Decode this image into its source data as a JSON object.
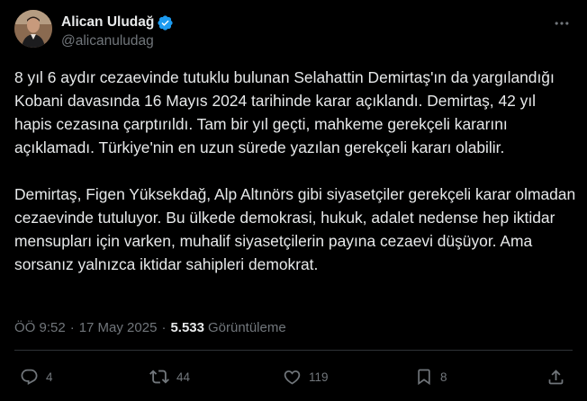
{
  "author": {
    "display_name": "Alican Uludağ",
    "handle": "@alicanuludag",
    "verified": true
  },
  "tweet": {
    "paragraphs": [
      "8 yıl 6 aydır cezaevinde tutuklu bulunan Selahattin Demirtaş'ın da yargılandığı Kobani davasında 16 Mayıs 2024 tarihinde karar açıklandı. Demirtaş, 42 yıl hapis cezasına çarptırıldı. Tam bir yıl geçti, mahkeme gerekçeli kararını açıklamadı. Türkiye'nin en uzun sürede yazılan gerekçeli kararı olabilir.",
      "Demirtaş, Figen Yüksekdağ, Alp Altınörs gibi siyasetçiler gerekçeli karar olmadan cezaevinde tutuluyor. Bu ülkede demokrasi, hukuk, adalet nedense hep iktidar mensupları için varken, muhalif siyasetçilerin payına cezaevi düşüyor. Ama sorsanız yalnızca iktidar sahipleri demokrat."
    ],
    "time": "ÖÖ 9:52",
    "separator": "·",
    "date": "17 May 2025",
    "views_count": "5.533",
    "views_label": "Görüntüleme"
  },
  "actions": {
    "replies": "4",
    "reposts": "44",
    "likes": "119",
    "bookmarks": "8"
  },
  "icons": {
    "more": "more-dots-icon",
    "verified": "verified-badge-icon",
    "reply": "reply-icon",
    "repost": "repost-icon",
    "like": "like-icon",
    "bookmark": "bookmark-icon",
    "share": "share-icon"
  },
  "colors": {
    "background": "#000000",
    "text_primary": "#e7e9ea",
    "text_secondary": "#71767b",
    "divider": "#2f3336",
    "verified_blue": "#1d9bf0"
  }
}
